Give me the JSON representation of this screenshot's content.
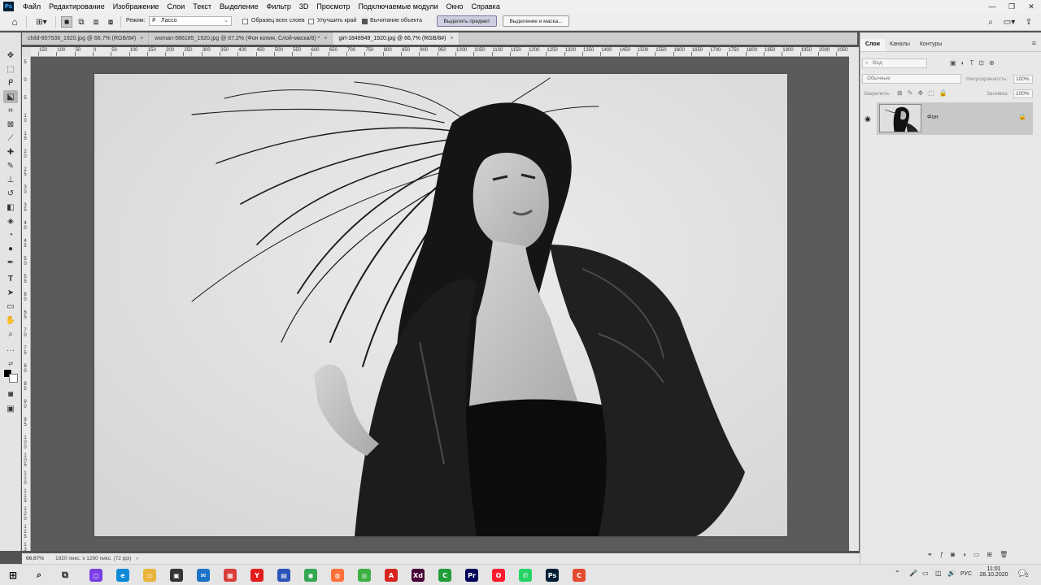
{
  "app": {
    "logo": "Ps"
  },
  "menu": [
    "Файл",
    "Редактирование",
    "Изображение",
    "Слои",
    "Текст",
    "Выделение",
    "Фильтр",
    "3D",
    "Просмотр",
    "Подключаемые модули",
    "Окно",
    "Справка"
  ],
  "options": {
    "mode_label": "Режим:",
    "mode_value": "Лассо",
    "sample_all_layers": "Образец всех слоев",
    "enhance_edge": "Улучшить край",
    "object_subtract": "Вычитание объекта",
    "select_subject": "Выделить предмет",
    "select_and_mask": "Выделение и маска..."
  },
  "tabs": [
    {
      "label": "child-807536_1920.jpg @ 66,7% (RGB/8#)",
      "close": "×"
    },
    {
      "label": "woman-586185_1920.jpg @ 67,2% (Фон копия, Слой-маска/8) *",
      "close": "×"
    },
    {
      "label": "girl-1848949_1920.jpg @ 66,7% (RGB/8#)",
      "close": "×"
    }
  ],
  "ruler_h": [
    "150",
    "100",
    "50",
    "0",
    "50",
    "100",
    "150",
    "200",
    "250",
    "300",
    "350",
    "400",
    "450",
    "500",
    "550",
    "600",
    "650",
    "700",
    "750",
    "800",
    "850",
    "900",
    "950",
    "1000",
    "1050",
    "1100",
    "1150",
    "1200",
    "1250",
    "1300",
    "1350",
    "1400",
    "1450",
    "1500",
    "1550",
    "1600",
    "1650",
    "1700",
    "1750",
    "1800",
    "1850",
    "1900",
    "1950",
    "2000",
    "2050"
  ],
  "ruler_v": [
    "5",
    "0",
    "5",
    "1 0",
    "1 5",
    "2 0",
    "2 5",
    "3 0",
    "3 5",
    "4 0",
    "4 5",
    "5 0",
    "5 5",
    "6 0",
    "6 5",
    "7 0",
    "7 5",
    "8 0",
    "8 5",
    "9 0",
    "9 5",
    "1 0 0",
    "1 0 5",
    "1 1 0",
    "1 1 5",
    "1 2 0",
    "1 2 5",
    "1 3 0",
    "1 3 5"
  ],
  "status": {
    "zoom": "66,67%",
    "doc_info": "1920 пикс. x 1280 пикс. (72 ppi)",
    "arrow": "›"
  },
  "layers_panel": {
    "tabs": [
      "Слои",
      "Каналы",
      "Контуры"
    ],
    "kind_placeholder": "Вид",
    "blend_mode": "Обычные",
    "opacity_label": "Непрозрачность:",
    "opacity_value": "100%",
    "lock_label": "Закрепить:",
    "fill_label": "Заливка:",
    "fill_value": "100%",
    "layers": [
      {
        "name": "Фон",
        "visible": true,
        "locked": true
      }
    ]
  },
  "taskbar": {
    "time": "11:01",
    "date": "28.10.2020",
    "lang": "РУС",
    "notifications": "2",
    "apps": [
      {
        "name": "cortana",
        "color": "#7b3fe4",
        "glyph": "○"
      },
      {
        "name": "edge",
        "color": "#0c8ad6",
        "glyph": "e"
      },
      {
        "name": "explorer",
        "color": "#e9b43c",
        "glyph": "▭"
      },
      {
        "name": "store",
        "color": "#333333",
        "glyph": "▣"
      },
      {
        "name": "mail",
        "color": "#1a73c7",
        "glyph": "✉"
      },
      {
        "name": "gifts",
        "color": "#d9403b",
        "glyph": "▦"
      },
      {
        "name": "yandex",
        "color": "#e21d1d",
        "glyph": "Y"
      },
      {
        "name": "notes",
        "color": "#2b53b8",
        "glyph": "▤"
      },
      {
        "name": "chrome",
        "color": "#34a853",
        "glyph": "◉"
      },
      {
        "name": "firefox",
        "color": "#ff7139",
        "glyph": "◍"
      },
      {
        "name": "camtasia",
        "color": "#3cb043",
        "glyph": "◎"
      },
      {
        "name": "acrobat",
        "color": "#d8261f",
        "glyph": "A"
      },
      {
        "name": "xd",
        "color": "#470137",
        "glyph": "Xd"
      },
      {
        "name": "camtasia-2",
        "color": "#1e9d3a",
        "glyph": "C"
      },
      {
        "name": "premiere",
        "color": "#00005b",
        "glyph": "Pr"
      },
      {
        "name": "opera",
        "color": "#ff1b2d",
        "glyph": "O"
      },
      {
        "name": "whatsapp",
        "color": "#25d366",
        "glyph": "✆"
      },
      {
        "name": "photoshop",
        "color": "#001e36",
        "glyph": "Ps"
      },
      {
        "name": "c-app",
        "color": "#e34a2f",
        "glyph": "C"
      }
    ]
  }
}
